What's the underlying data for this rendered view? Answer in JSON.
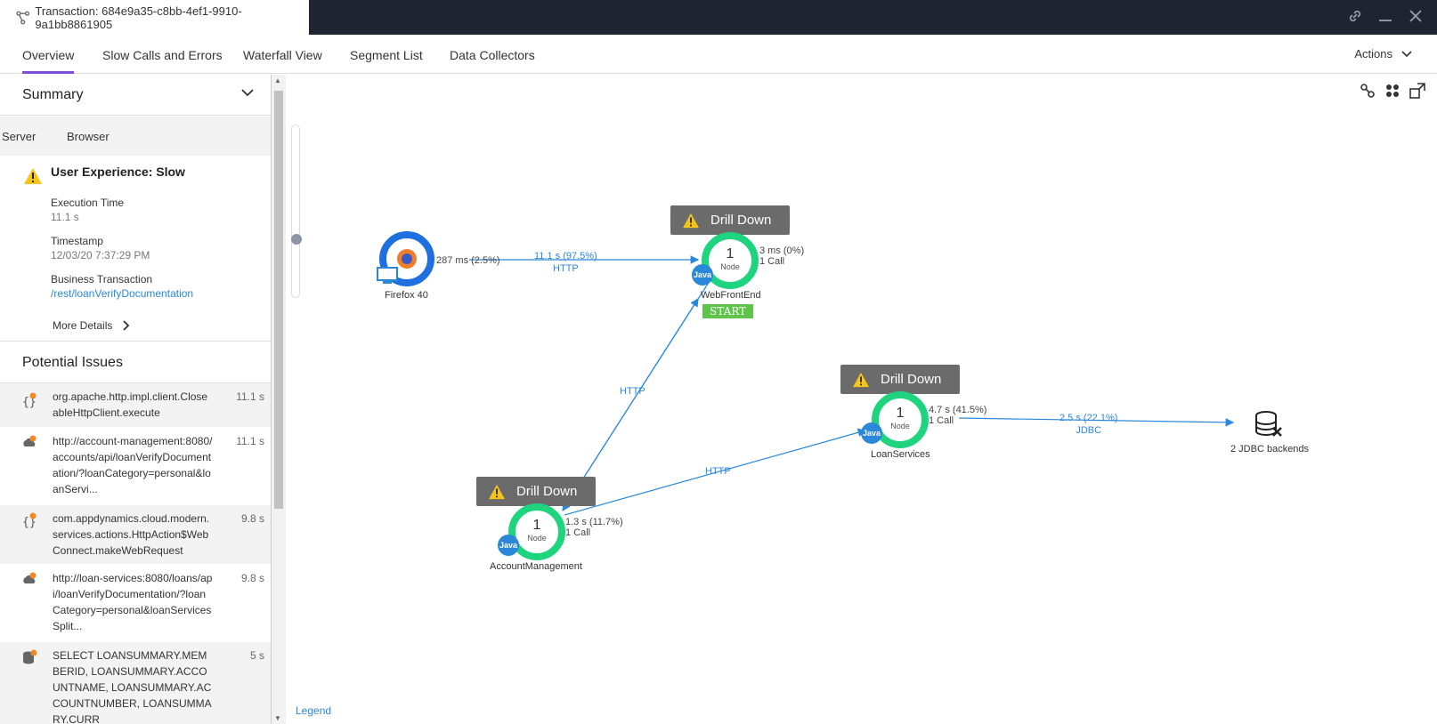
{
  "window": {
    "title": "Transaction: 684e9a35-c8bb-4ef1-9910-9a1bb8861905",
    "icons": [
      "link-icon",
      "minimize-icon",
      "close-icon"
    ]
  },
  "tabs": [
    "Overview",
    "Slow Calls and Errors",
    "Waterfall View",
    "Segment List",
    "Data Collectors"
  ],
  "actions_label": "Actions",
  "summary": {
    "title": "Summary",
    "subtabs": [
      "Server",
      "Browser"
    ],
    "ux_title": "User Experience: Slow",
    "exec_label": "Execution Time",
    "exec_value": "11.1 s",
    "ts_label": "Timestamp",
    "ts_value": "12/03/20 7:37:29 PM",
    "bt_label": "Business Transaction",
    "bt_value": "/rest/loanVerifyDocumentation",
    "more_details": "More Details"
  },
  "potential_issues": {
    "title": "Potential Issues",
    "items": [
      {
        "icon": "code-warning-icon",
        "text": "org.apache.http.impl.client.CloseableHttpClient.execute",
        "time": "11.1 s"
      },
      {
        "icon": "cloud-warning-icon",
        "text": "http://account-management:8080/accounts/api/loanVerifyDocumentation/?loanCategory=personal&loanServi...",
        "time": "11.1 s"
      },
      {
        "icon": "code-warning-icon",
        "text": "com.appdynamics.cloud.modern.services.actions.HttpAction$WebConnect.makeWebRequest",
        "time": "9.8 s"
      },
      {
        "icon": "cloud-warning-icon",
        "text": "http://loan-services:8080/loans/api/loanVerifyDocumentation/?loanCategory=personal&loanServicesSplit...",
        "time": "9.8 s"
      },
      {
        "icon": "database-warning-icon",
        "text": "SELECT LOANSUMMARY.MEMBERID, LOANSUMMARY.ACCOUNTNAME, LOANSUMMARY.ACCOUNTNUMBER, LOANSUMMARY.CURR",
        "time": "5 s"
      }
    ]
  },
  "flowmap": {
    "drill_label": "Drill Down",
    "node_count": "1",
    "node_word": "Node",
    "java_label": "Java",
    "start_label": "START",
    "legend_label": "Legend",
    "browser": {
      "name": "Firefox 40",
      "stat": "287 ms (2.5%)"
    },
    "web": {
      "name": "WebFrontEnd",
      "stat1": "3 ms (0%)",
      "stat2": "1 Call"
    },
    "acct": {
      "name": "AccountManagement",
      "stat1": "1.3 s (11.7%)",
      "stat2": "1 Call"
    },
    "loan": {
      "name": "LoanServices",
      "stat1": "4.7 s (41.5%)",
      "stat2": "1 Call"
    },
    "jdbc": {
      "name": "2 JDBC backends"
    },
    "edge_browser_web": {
      "value": "11.1 s (97.5%)",
      "proto": "HTTP"
    },
    "edge_web_acct": {
      "proto": "HTTP"
    },
    "edge_acct_loan": {
      "proto": "HTTP"
    },
    "edge_loan_jdbc": {
      "value": "2.5 s (22.1%)",
      "proto": "JDBC"
    }
  },
  "colors": {
    "accent": "#7a4fd8",
    "node_ring": "#1ed47f",
    "link": "#2b88d8",
    "titlebar": "#1f2530"
  }
}
